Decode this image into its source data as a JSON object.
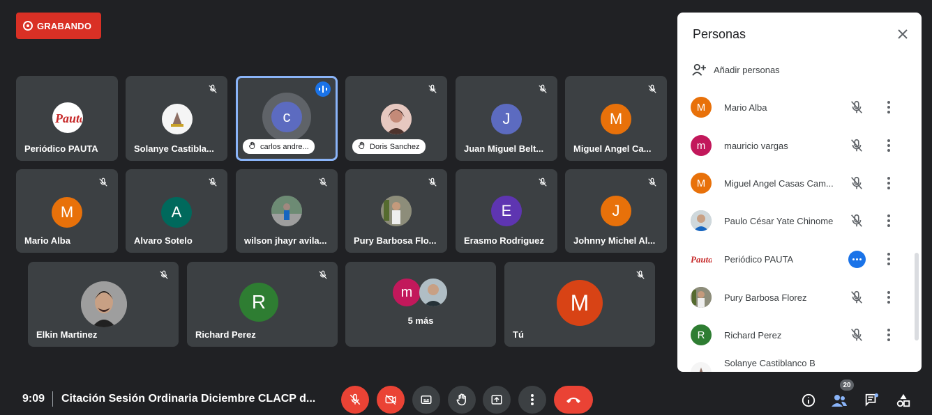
{
  "recording": {
    "label": "GRABANDO"
  },
  "tiles": [
    {
      "name": "Periódico PAUTA"
    },
    {
      "name": "Solanye Castibla..."
    },
    {
      "name": "carlos andre...",
      "initial": "c"
    },
    {
      "name": "Doris Sanchez"
    },
    {
      "name": "Juan Miguel Belt...",
      "initial": "J"
    },
    {
      "name": "Miguel Angel Ca...",
      "initial": "M"
    },
    {
      "name": "Mario Alba",
      "initial": "M"
    },
    {
      "name": "Alvaro Sotelo",
      "initial": "A"
    },
    {
      "name": "wilson jhayr avila..."
    },
    {
      "name": "Pury Barbosa Flo..."
    },
    {
      "name": "Erasmo Rodriguez",
      "initial": "E"
    },
    {
      "name": "Johnny Michel Al...",
      "initial": "J"
    },
    {
      "name": "Elkin Martinez"
    },
    {
      "name": "Richard Perez",
      "initial": "R"
    },
    {
      "name": "5 más",
      "initial": "m"
    },
    {
      "name": "Tú",
      "initial": "M"
    }
  ],
  "bottom_bar": {
    "time": "9:09",
    "meeting_title": "Citación Sesión Ordinaria Diciembre CLACP d...",
    "participant_count": "20"
  },
  "panel": {
    "title": "Personas",
    "add_people": "Añadir personas",
    "people": [
      {
        "name": "Mario Alba",
        "initial": "M",
        "color": "#e8710a"
      },
      {
        "name": "mauricio vargas",
        "initial": "m",
        "color": "#c2185b"
      },
      {
        "name": "Miguel Angel Casas Cam...",
        "initial": "M",
        "color": "#e8710a"
      },
      {
        "name": "Paulo César Yate Chinome",
        "initial": ""
      },
      {
        "name": "Periódico PAUTA",
        "initial": ""
      },
      {
        "name": "Pury Barbosa Florez",
        "initial": ""
      },
      {
        "name": "Richard Perez",
        "initial": "R",
        "color": "#2e7d32"
      },
      {
        "name": "Solanye Castiblanco B",
        "initial": ""
      }
    ]
  },
  "colors": {
    "accent": "#1a73e8",
    "danger": "#ea4335",
    "tile": "#3c4043",
    "bg": "#202124"
  }
}
